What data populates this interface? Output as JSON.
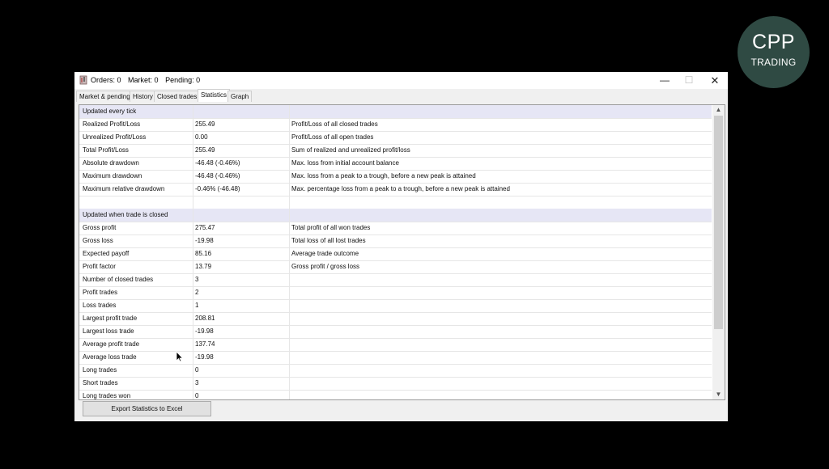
{
  "logo": {
    "line1": "CPP",
    "line2": "TRADING"
  },
  "titlebar": {
    "orders": "Orders: 0",
    "market": "Market: 0",
    "pending": "Pending: 0",
    "min": "—",
    "max": "☐",
    "close": "✕"
  },
  "tabs": [
    "Market & pending",
    "History",
    "Closed trades",
    "Statistics",
    "Graph"
  ],
  "active_tab": "Statistics",
  "rows": [
    {
      "type": "section",
      "label": "Updated every tick"
    },
    {
      "label": "Realized Profit/Loss",
      "value": "255.49",
      "desc": "Profit/Loss of all closed trades"
    },
    {
      "label": "Unrealized Profit/Loss",
      "value": "0.00",
      "desc": "Profit/Loss of all open trades"
    },
    {
      "label": "Total Profit/Loss",
      "value": "255.49",
      "desc": "Sum of realized and unrealized profit/loss"
    },
    {
      "label": "Absolute drawdown",
      "value": "-46.48 (-0.46%)",
      "desc": "Max. loss from initial account balance"
    },
    {
      "label": "Maximum drawdown",
      "value": "-46.48 (-0.46%)",
      "desc": "Max. loss from a peak to a trough, before a new peak is attained"
    },
    {
      "label": "Maximum relative drawdown",
      "value": "-0.46% (-46.48)",
      "desc": "Max. percentage loss from a peak to a trough, before a new peak is attained"
    },
    {
      "label": "",
      "value": "",
      "desc": ""
    },
    {
      "type": "section",
      "label": "Updated when trade is closed"
    },
    {
      "label": "Gross profit",
      "value": "275.47",
      "desc": "Total profit of all won trades"
    },
    {
      "label": "Gross loss",
      "value": "-19.98",
      "desc": "Total loss of all lost trades"
    },
    {
      "label": "Expected payoff",
      "value": "85.16",
      "desc": "Average trade outcome"
    },
    {
      "label": "Profit factor",
      "value": "13.79",
      "desc": "Gross profit / gross loss"
    },
    {
      "label": "Number of closed trades",
      "value": "3",
      "desc": ""
    },
    {
      "label": "Profit trades",
      "value": "2",
      "desc": ""
    },
    {
      "label": "Loss trades",
      "value": "1",
      "desc": ""
    },
    {
      "label": "Largest profit trade",
      "value": "208.81",
      "desc": ""
    },
    {
      "label": "Largest loss trade",
      "value": "-19.98",
      "desc": ""
    },
    {
      "label": "Average profit trade",
      "value": "137.74",
      "desc": ""
    },
    {
      "label": "Average loss trade",
      "value": "-19.98",
      "desc": ""
    },
    {
      "label": "Long trades",
      "value": "0",
      "desc": ""
    },
    {
      "label": "Short trades",
      "value": "3",
      "desc": ""
    },
    {
      "label": "Long trades won",
      "value": "0",
      "desc": ""
    }
  ],
  "export_button": "Export Statistics to Excel",
  "colors": {
    "section_bg": "#e6e6f5",
    "background": "#000000",
    "logo_bg": "#2f4a43"
  }
}
